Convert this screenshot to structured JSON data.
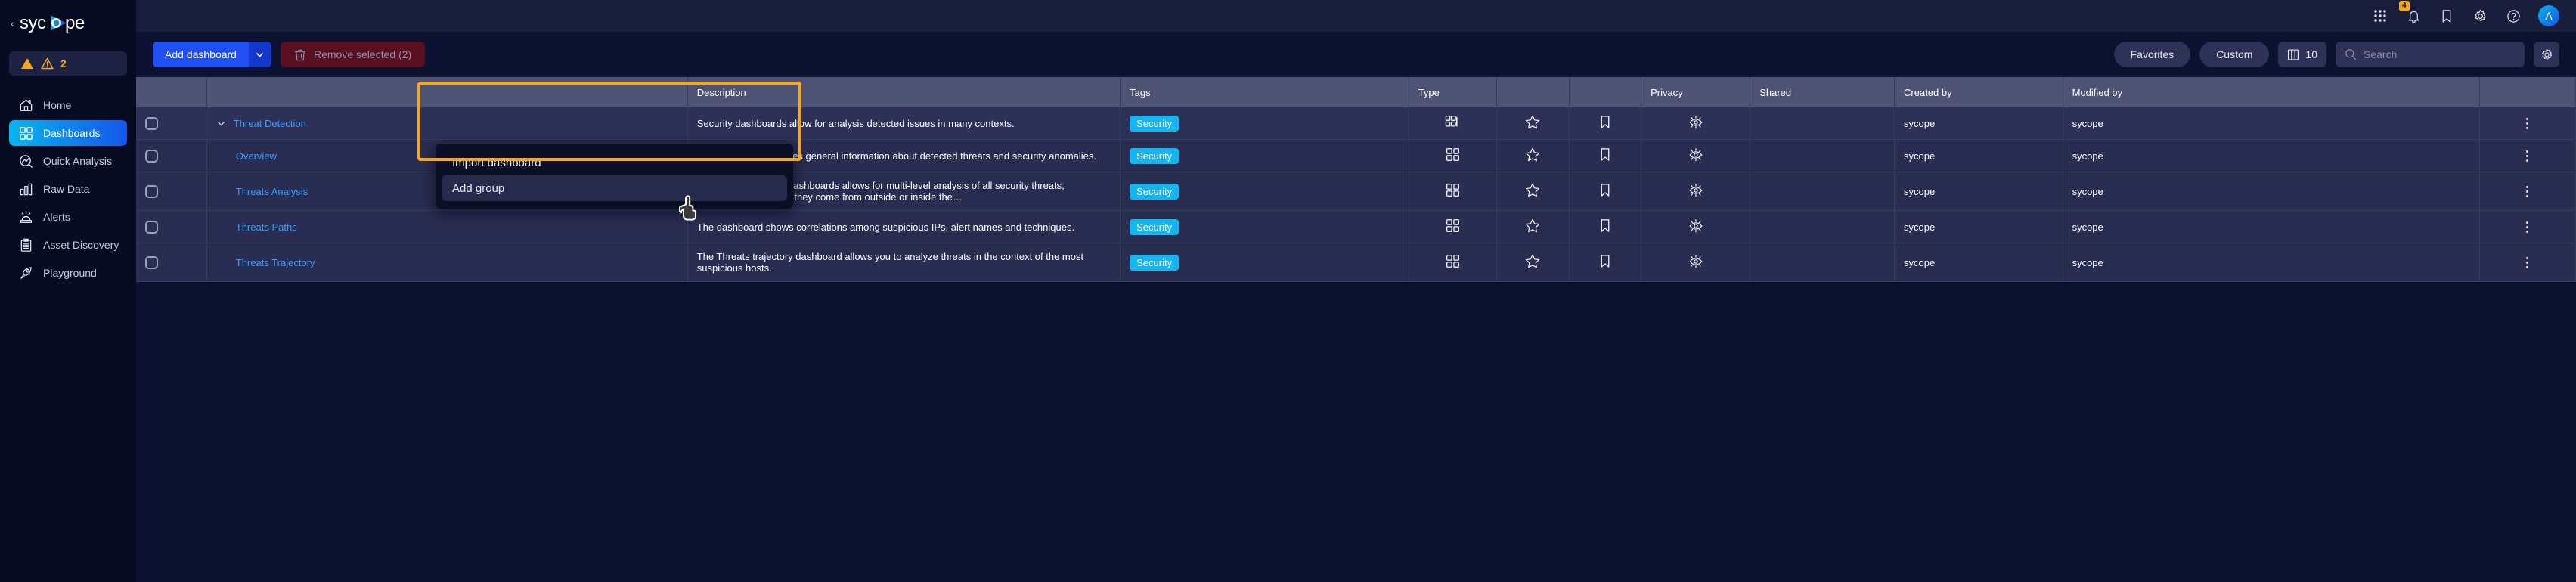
{
  "sidebar": {
    "brand_name": "sycope",
    "collapse_icon": "chevron-left-icon",
    "alert": {
      "icon": "warning-triangle-icon",
      "count": "2"
    },
    "items": [
      {
        "label": "Home",
        "icon": "home-icon",
        "active": false
      },
      {
        "label": "Dashboards",
        "icon": "grid-icon",
        "active": true
      },
      {
        "label": "Quick Analysis",
        "icon": "analysis-icon",
        "active": false
      },
      {
        "label": "Raw Data",
        "icon": "bar-chart-icon",
        "active": false
      },
      {
        "label": "Alerts",
        "icon": "siren-icon",
        "active": false
      },
      {
        "label": "Asset Discovery",
        "icon": "clipboard-icon",
        "active": false
      },
      {
        "label": "Playground",
        "icon": "rocket-icon",
        "active": false
      }
    ]
  },
  "topbar": {
    "icons": [
      {
        "name": "apps-grid-icon"
      },
      {
        "name": "bell-icon",
        "badge": "4"
      },
      {
        "name": "bookmark-icon"
      },
      {
        "name": "gear-icon"
      },
      {
        "name": "help-icon"
      }
    ],
    "avatar_initial": "A"
  },
  "toolbar": {
    "add_dashboard_label": "Add dashboard",
    "add_dashboard_caret": "chevron-down-icon",
    "remove_selected_label": "Remove selected (2)",
    "remove_icon": "trash-icon",
    "favorites_label": "Favorites",
    "custom_label": "Custom",
    "columns_icon": "columns-icon",
    "columns_count": "10",
    "search_placeholder": "Search",
    "search_value": "",
    "search_icon": "search-icon",
    "settings_icon": "gear-icon"
  },
  "dropdown": {
    "items": [
      {
        "label": "Import dashboard",
        "hovered": false
      },
      {
        "label": "Add group",
        "hovered": true
      }
    ]
  },
  "table": {
    "columns": [
      {
        "key": "check",
        "label": ""
      },
      {
        "key": "name",
        "label": ""
      },
      {
        "key": "description",
        "label": "Description"
      },
      {
        "key": "tags",
        "label": "Tags"
      },
      {
        "key": "type",
        "label": "Type"
      },
      {
        "key": "fav",
        "label": ""
      },
      {
        "key": "bookmark",
        "label": ""
      },
      {
        "key": "privacy",
        "label": "Privacy"
      },
      {
        "key": "shared",
        "label": "Shared"
      },
      {
        "key": "created_by",
        "label": "Created by"
      },
      {
        "key": "modified_by",
        "label": "Modified by"
      },
      {
        "key": "actions",
        "label": ""
      }
    ],
    "rows": [
      {
        "name": "Threat Detection",
        "is_group": true,
        "expand_icon": "chevron-down-icon",
        "description": "Security dashboards allow for analysis detected issues in many contexts.",
        "tag": "Security",
        "type_icon": "dashboard-group-icon",
        "fav_icon": "star-icon",
        "bookmark_icon": "bookmark-icon",
        "privacy_icon": "eye-public-icon",
        "shared": "",
        "created_by": "sycope",
        "modified_by": "sycope",
        "actions_icon": "kebab-menu-icon"
      },
      {
        "name": "Overview",
        "is_group": false,
        "description": "The dashboard provides general information about detected threats and security anomalies.",
        "tag": "Security",
        "type_icon": "dashboard-icon",
        "fav_icon": "star-icon",
        "bookmark_icon": "bookmark-icon",
        "privacy_icon": "eye-public-icon",
        "shared": "",
        "created_by": "sycope",
        "modified_by": "sycope",
        "actions_icon": "kebab-menu-icon"
      },
      {
        "name": "Threats Analysis",
        "is_group": false,
        "description": "The Threat Analysis Dashboards allows for multi-level analysis of all security threats, regardless of whether they come from outside or inside the…",
        "tag": "Security",
        "type_icon": "dashboard-icon",
        "fav_icon": "star-icon",
        "bookmark_icon": "bookmark-icon",
        "privacy_icon": "eye-public-icon",
        "shared": "",
        "created_by": "sycope",
        "modified_by": "sycope",
        "actions_icon": "kebab-menu-icon"
      },
      {
        "name": "Threats Paths",
        "is_group": false,
        "description": "The dashboard shows correlations among suspicious IPs, alert names and techniques.",
        "tag": "Security",
        "type_icon": "dashboard-icon",
        "fav_icon": "star-icon",
        "bookmark_icon": "bookmark-icon",
        "privacy_icon": "eye-public-icon",
        "shared": "",
        "created_by": "sycope",
        "modified_by": "sycope",
        "actions_icon": "kebab-menu-icon"
      },
      {
        "name": "Threats Trajectory",
        "is_group": false,
        "description": "The Threats trajectory dashboard allows you to analyze threats in the context of the most suspicious hosts.",
        "tag": "Security",
        "type_icon": "dashboard-icon",
        "fav_icon": "star-icon",
        "bookmark_icon": "bookmark-icon",
        "privacy_icon": "eye-public-icon",
        "shared": "",
        "created_by": "sycope",
        "modified_by": "sycope",
        "actions_icon": "kebab-menu-icon"
      }
    ]
  },
  "colors": {
    "sidebar_bg": "#070b21",
    "main_bg": "#0d1130",
    "topbar_bg": "#1a1e3d",
    "accent_blue": "#1f4ff5",
    "link_blue": "#3d9bfd",
    "tag_cyan": "#17b5ef",
    "highlight_amber": "#f5a623",
    "danger_red": "#5a1020",
    "header_row": "#4e5275",
    "row_bg": "#292d52"
  }
}
